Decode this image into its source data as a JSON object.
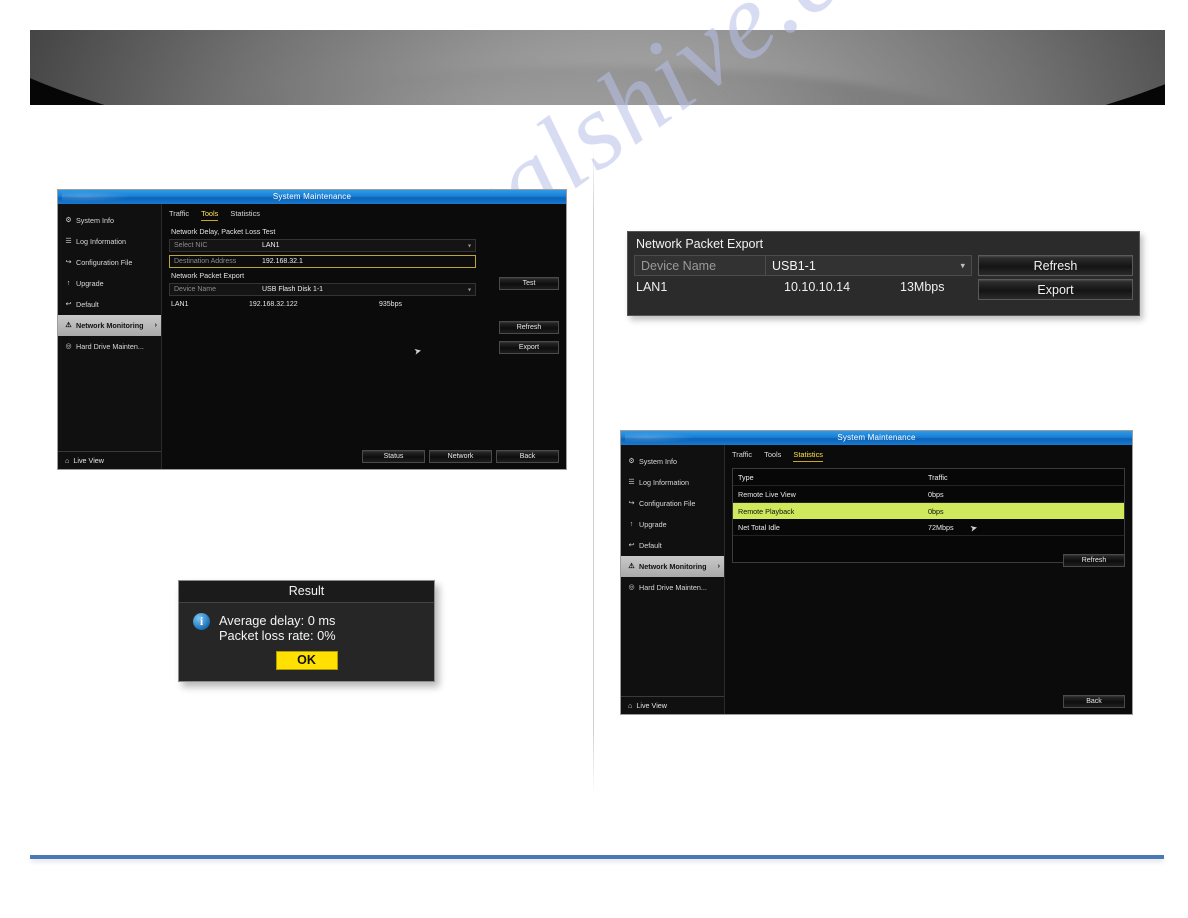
{
  "watermark": {
    "text": "manualshive.com"
  },
  "panel_tools": {
    "title": "System Maintenance",
    "tabs": [
      {
        "label": "Traffic",
        "active": false
      },
      {
        "label": "Tools",
        "active": true
      },
      {
        "label": "Statistics",
        "active": false
      }
    ],
    "sidebar": {
      "items": [
        {
          "label": "System Info",
          "icon": "info-icon",
          "glyph": "⚙",
          "active": false
        },
        {
          "label": "Log Information",
          "icon": "log-icon",
          "glyph": "☰",
          "active": false
        },
        {
          "label": "Configuration File",
          "icon": "config-icon",
          "glyph": "↪",
          "active": false
        },
        {
          "label": "Upgrade",
          "icon": "upgrade-icon",
          "glyph": "↑",
          "active": false
        },
        {
          "label": "Default",
          "icon": "default-icon",
          "glyph": "↩",
          "active": false
        },
        {
          "label": "Network Monitoring",
          "icon": "network-icon",
          "glyph": "⚠",
          "active": true,
          "chevron": "›"
        },
        {
          "label": "Hard Drive Mainten...",
          "icon": "harddrive-icon",
          "glyph": "◎",
          "active": false
        }
      ],
      "footer": {
        "label": "Live View",
        "icon": "home-icon",
        "glyph": "⌂"
      }
    },
    "section_delay": "Network Delay, Packet Loss Test",
    "select_nic": {
      "label": "Select NIC",
      "value": "LAN1"
    },
    "destination": {
      "label": "Destination Address",
      "value": "192.168.32.1"
    },
    "section_export": "Network Packet Export",
    "device_name": {
      "label": "Device Name",
      "value": "USB Flash Disk 1-1"
    },
    "lan_row": {
      "nic": "LAN1",
      "address": "192.168.32.122",
      "rate": "935bps"
    },
    "buttons": {
      "test": "Test",
      "refresh": "Refresh",
      "export": "Export",
      "status": "Status",
      "network": "Network",
      "back": "Back"
    }
  },
  "dialog_result": {
    "title": "Result",
    "icon": "info-icon",
    "line1": "Average delay: 0 ms",
    "line2": "Packet loss rate: 0%",
    "ok_label": "OK"
  },
  "panel_npe": {
    "header": "Network Packet Export",
    "device_name": {
      "label": "Device Name",
      "value": "USB1-1"
    },
    "lan_row": {
      "nic": "LAN1",
      "address": "10.10.10.14",
      "rate": "13Mbps"
    },
    "buttons": {
      "refresh": "Refresh",
      "export": "Export"
    }
  },
  "panel_stats": {
    "title": "System Maintenance",
    "tabs": [
      {
        "label": "Traffic",
        "active": false
      },
      {
        "label": "Tools",
        "active": false
      },
      {
        "label": "Statistics",
        "active": true
      }
    ],
    "sidebar": {
      "items": [
        {
          "label": "System Info",
          "icon": "info-icon",
          "glyph": "⚙",
          "active": false
        },
        {
          "label": "Log Information",
          "icon": "log-icon",
          "glyph": "☰",
          "active": false
        },
        {
          "label": "Configuration File",
          "icon": "config-icon",
          "glyph": "↪",
          "active": false
        },
        {
          "label": "Upgrade",
          "icon": "upgrade-icon",
          "glyph": "↑",
          "active": false
        },
        {
          "label": "Default",
          "icon": "default-icon",
          "glyph": "↩",
          "active": false
        },
        {
          "label": "Network Monitoring",
          "icon": "network-icon",
          "glyph": "⚠",
          "active": true,
          "chevron": "›"
        },
        {
          "label": "Hard Drive Mainten...",
          "icon": "harddrive-icon",
          "glyph": "◎",
          "active": false
        }
      ],
      "footer": {
        "label": "Live View",
        "icon": "home-icon",
        "glyph": "⌂"
      }
    },
    "table": {
      "headers": [
        "Type",
        "Traffic"
      ],
      "rows": [
        {
          "type": "Remote Live View",
          "traffic": "0bps",
          "selected": false
        },
        {
          "type": "Remote Playback",
          "traffic": "0bps",
          "selected": true
        },
        {
          "type": "Net Total Idle",
          "traffic": "72Mbps",
          "selected": false
        }
      ]
    },
    "buttons": {
      "refresh": "Refresh",
      "back": "Back"
    }
  },
  "colors": {
    "title_blue": "#1a7fd4",
    "tab_active": "#ffe14d",
    "row_highlight": "#cfe85c",
    "ok_button": "#ffe000",
    "rule_blue": "#4a7ab5"
  }
}
